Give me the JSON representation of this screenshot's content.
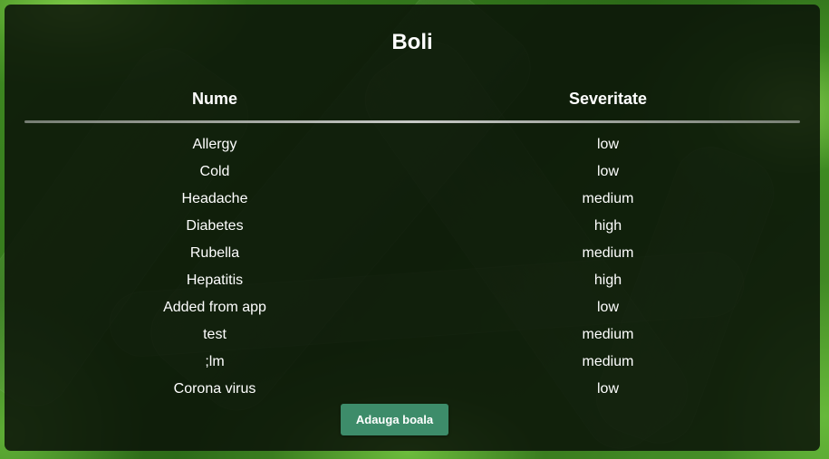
{
  "title": "Boli",
  "table": {
    "headers": {
      "name": "Nume",
      "severity": "Severitate"
    },
    "rows": [
      {
        "name": "Allergy",
        "severity": "low"
      },
      {
        "name": "Cold",
        "severity": "low"
      },
      {
        "name": "Headache",
        "severity": "medium"
      },
      {
        "name": "Diabetes",
        "severity": "high"
      },
      {
        "name": "Rubella",
        "severity": "medium"
      },
      {
        "name": "Hepatitis",
        "severity": "high"
      },
      {
        "name": "Added from app",
        "severity": "low"
      },
      {
        "name": "test",
        "severity": "medium"
      },
      {
        "name": ";lm",
        "severity": "medium"
      },
      {
        "name": "Corona virus",
        "severity": "low"
      }
    ]
  },
  "actions": {
    "add_label": "Adauga boala"
  },
  "colors": {
    "button": "#3d8c6a",
    "background_green": "#4f9a2a",
    "card": "#0a1208"
  }
}
